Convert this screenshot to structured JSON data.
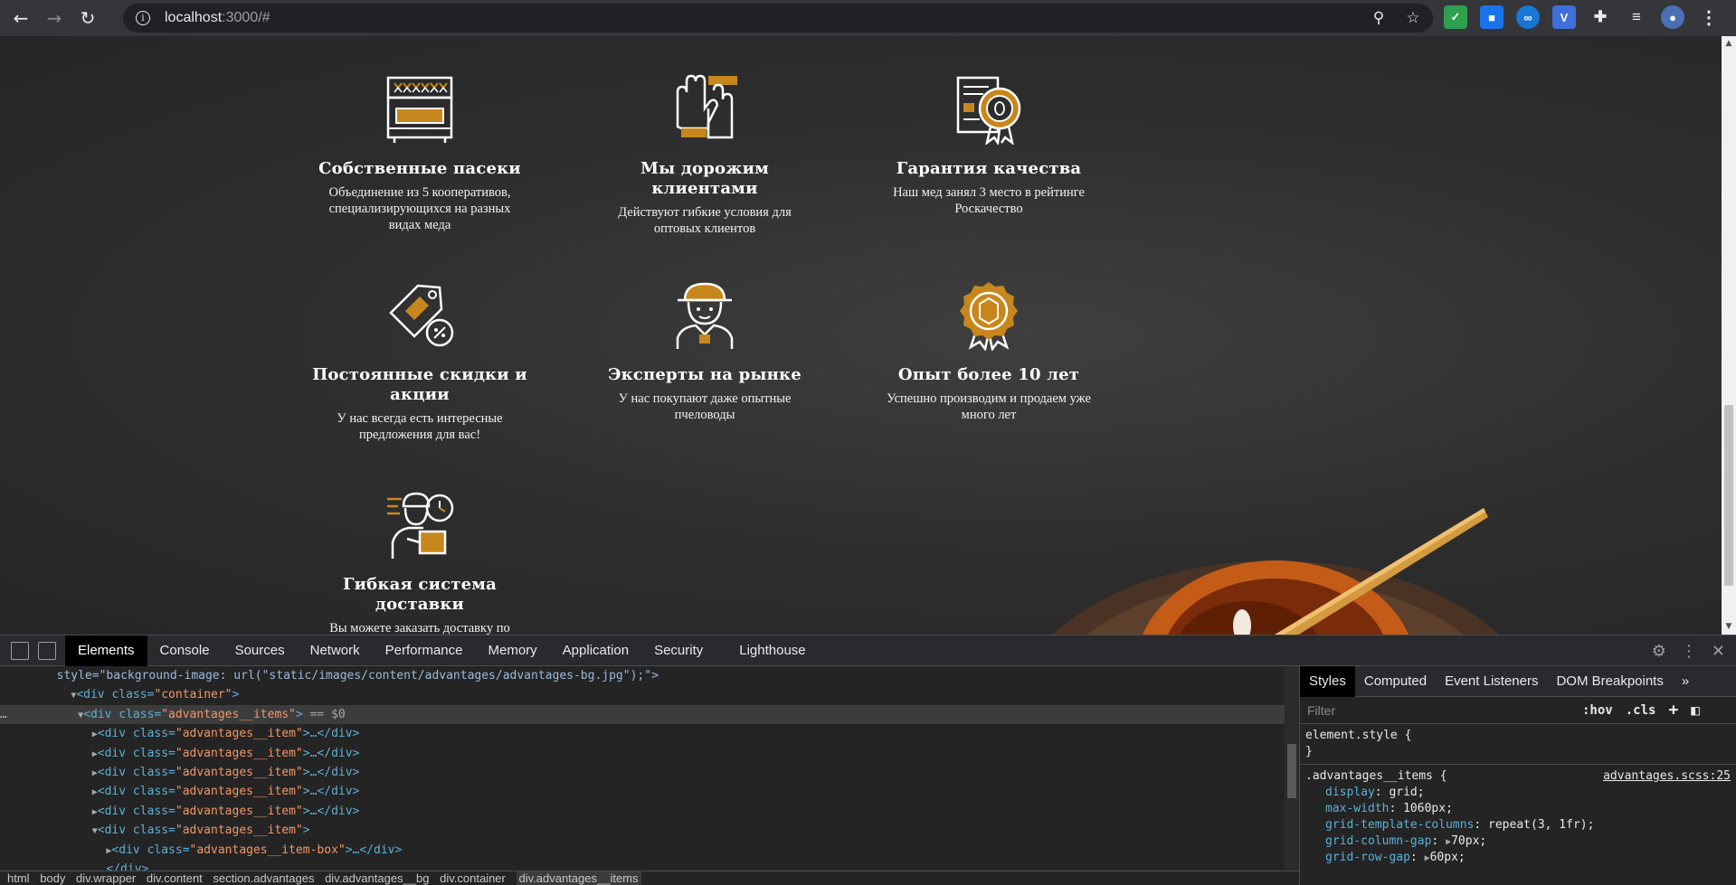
{
  "browser": {
    "url_host": "localhost",
    "url_rest": ":3000/#"
  },
  "advantages": [
    {
      "title": "Собственные пасеки",
      "desc": "Объединение из 5 кооперативов, специализирующихся на разных видах меда",
      "icon": "hive-box-icon"
    },
    {
      "title": "Мы дорожим клиентами",
      "desc": "Действуют гибкие условия для оптовых клиентов",
      "icon": "handshake-gloves-icon"
    },
    {
      "title": "Гарантия качества",
      "desc": "Наш мед занял 3 место в рейтинге Роскачество",
      "icon": "certificate-icon"
    },
    {
      "title": "Постоянные скидки и акции",
      "desc": "У нас всегда есть интересные предложения для вас!",
      "icon": "discount-tag-icon"
    },
    {
      "title": "Эксперты на рынке",
      "desc": "У нас покупают даже опытные пчеловоды",
      "icon": "beekeeper-icon"
    },
    {
      "title": "Опыт более 10 лет",
      "desc": "Успешно производим и продаем уже много лет",
      "icon": "medal-icon"
    },
    {
      "title": "Гибкая система доставки",
      "desc": "Вы можете заказать доставку по",
      "icon": "delivery-icon"
    }
  ],
  "devtools": {
    "tabs": [
      "Elements",
      "Console",
      "Sources",
      "Network",
      "Performance",
      "Memory",
      "Application",
      "Security",
      "Lighthouse"
    ],
    "active_tab": "Elements",
    "dom_lines": {
      "l1": "style=\"background-image: url(\"static/images/content/advantages/advantages-bg.jpg\");\">",
      "l2_tag": "<div class=",
      "l2_val": "\"container\"",
      "l3_val": "\"advantages__items\"",
      "l3_dollar": "== $0",
      "item_val": "\"advantages__item\"",
      "collapsed": "…</div>",
      "box_val": "\"advantages__item-box\"",
      "last": "</div>"
    },
    "breadcrumbs": [
      "html",
      "body",
      "div.wrapper",
      "div.content",
      "section.advantages",
      "div.advantages__bg",
      "div.container",
      "div.advantages__items"
    ],
    "styles_tabs": [
      "Styles",
      "Computed",
      "Event Listeners",
      "DOM Breakpoints"
    ],
    "filter_placeholder": "Filter",
    "filter_hov": ":hov",
    "filter_cls": ".cls",
    "element_style": "element.style {",
    "close_brace": "}",
    "rule_selector": ".advantages__items {",
    "rule_source": "advantages.scss:25",
    "rule_props": [
      {
        "name": "display",
        "value": "grid;"
      },
      {
        "name": "max-width",
        "value": "1060px;"
      },
      {
        "name": "grid-template-columns",
        "value": "repeat(3, 1fr);"
      },
      {
        "name": "grid-column-gap",
        "value": "70px;"
      },
      {
        "name": "grid-row-gap",
        "value": "60px;"
      }
    ]
  },
  "colors": {
    "accent": "#c8871c",
    "icon_white": "#ffffff"
  }
}
